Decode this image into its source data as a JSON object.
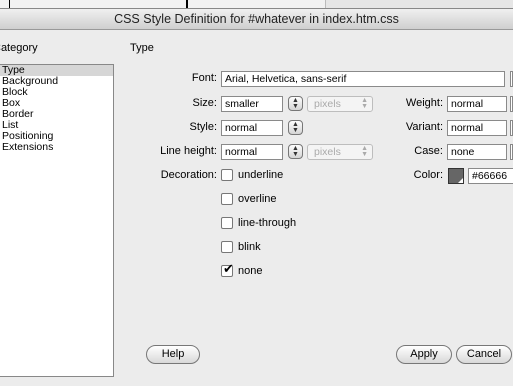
{
  "window": {
    "title": "CSS Style Definition for #whatever in index.htm.css"
  },
  "category": {
    "header": "Category",
    "items": [
      "Type",
      "Background",
      "Block",
      "Box",
      "Border",
      "List",
      "Positioning",
      "Extensions"
    ],
    "selected": "Type"
  },
  "panel": {
    "header": "Type",
    "font": {
      "label": "Font:",
      "value": "Arial, Helvetica, sans-serif"
    },
    "size": {
      "label": "Size:",
      "value": "smaller",
      "units": "pixels"
    },
    "weight": {
      "label": "Weight:",
      "value": "normal"
    },
    "style": {
      "label": "Style:",
      "value": "normal"
    },
    "variant": {
      "label": "Variant:",
      "value": "normal"
    },
    "line_height": {
      "label": "Line height:",
      "value": "normal",
      "units": "pixels"
    },
    "case": {
      "label": "Case:",
      "value": "none"
    },
    "decoration": {
      "label": "Decoration:",
      "options": [
        {
          "label": "underline",
          "checked": false
        },
        {
          "label": "overline",
          "checked": false
        },
        {
          "label": "line-through",
          "checked": false
        },
        {
          "label": "blink",
          "checked": false
        },
        {
          "label": "none",
          "checked": true
        }
      ]
    },
    "color": {
      "label": "Color:",
      "value": "#66666",
      "swatch": "#666666"
    }
  },
  "buttons": {
    "help": "Help",
    "apply": "Apply",
    "cancel": "Cancel"
  }
}
